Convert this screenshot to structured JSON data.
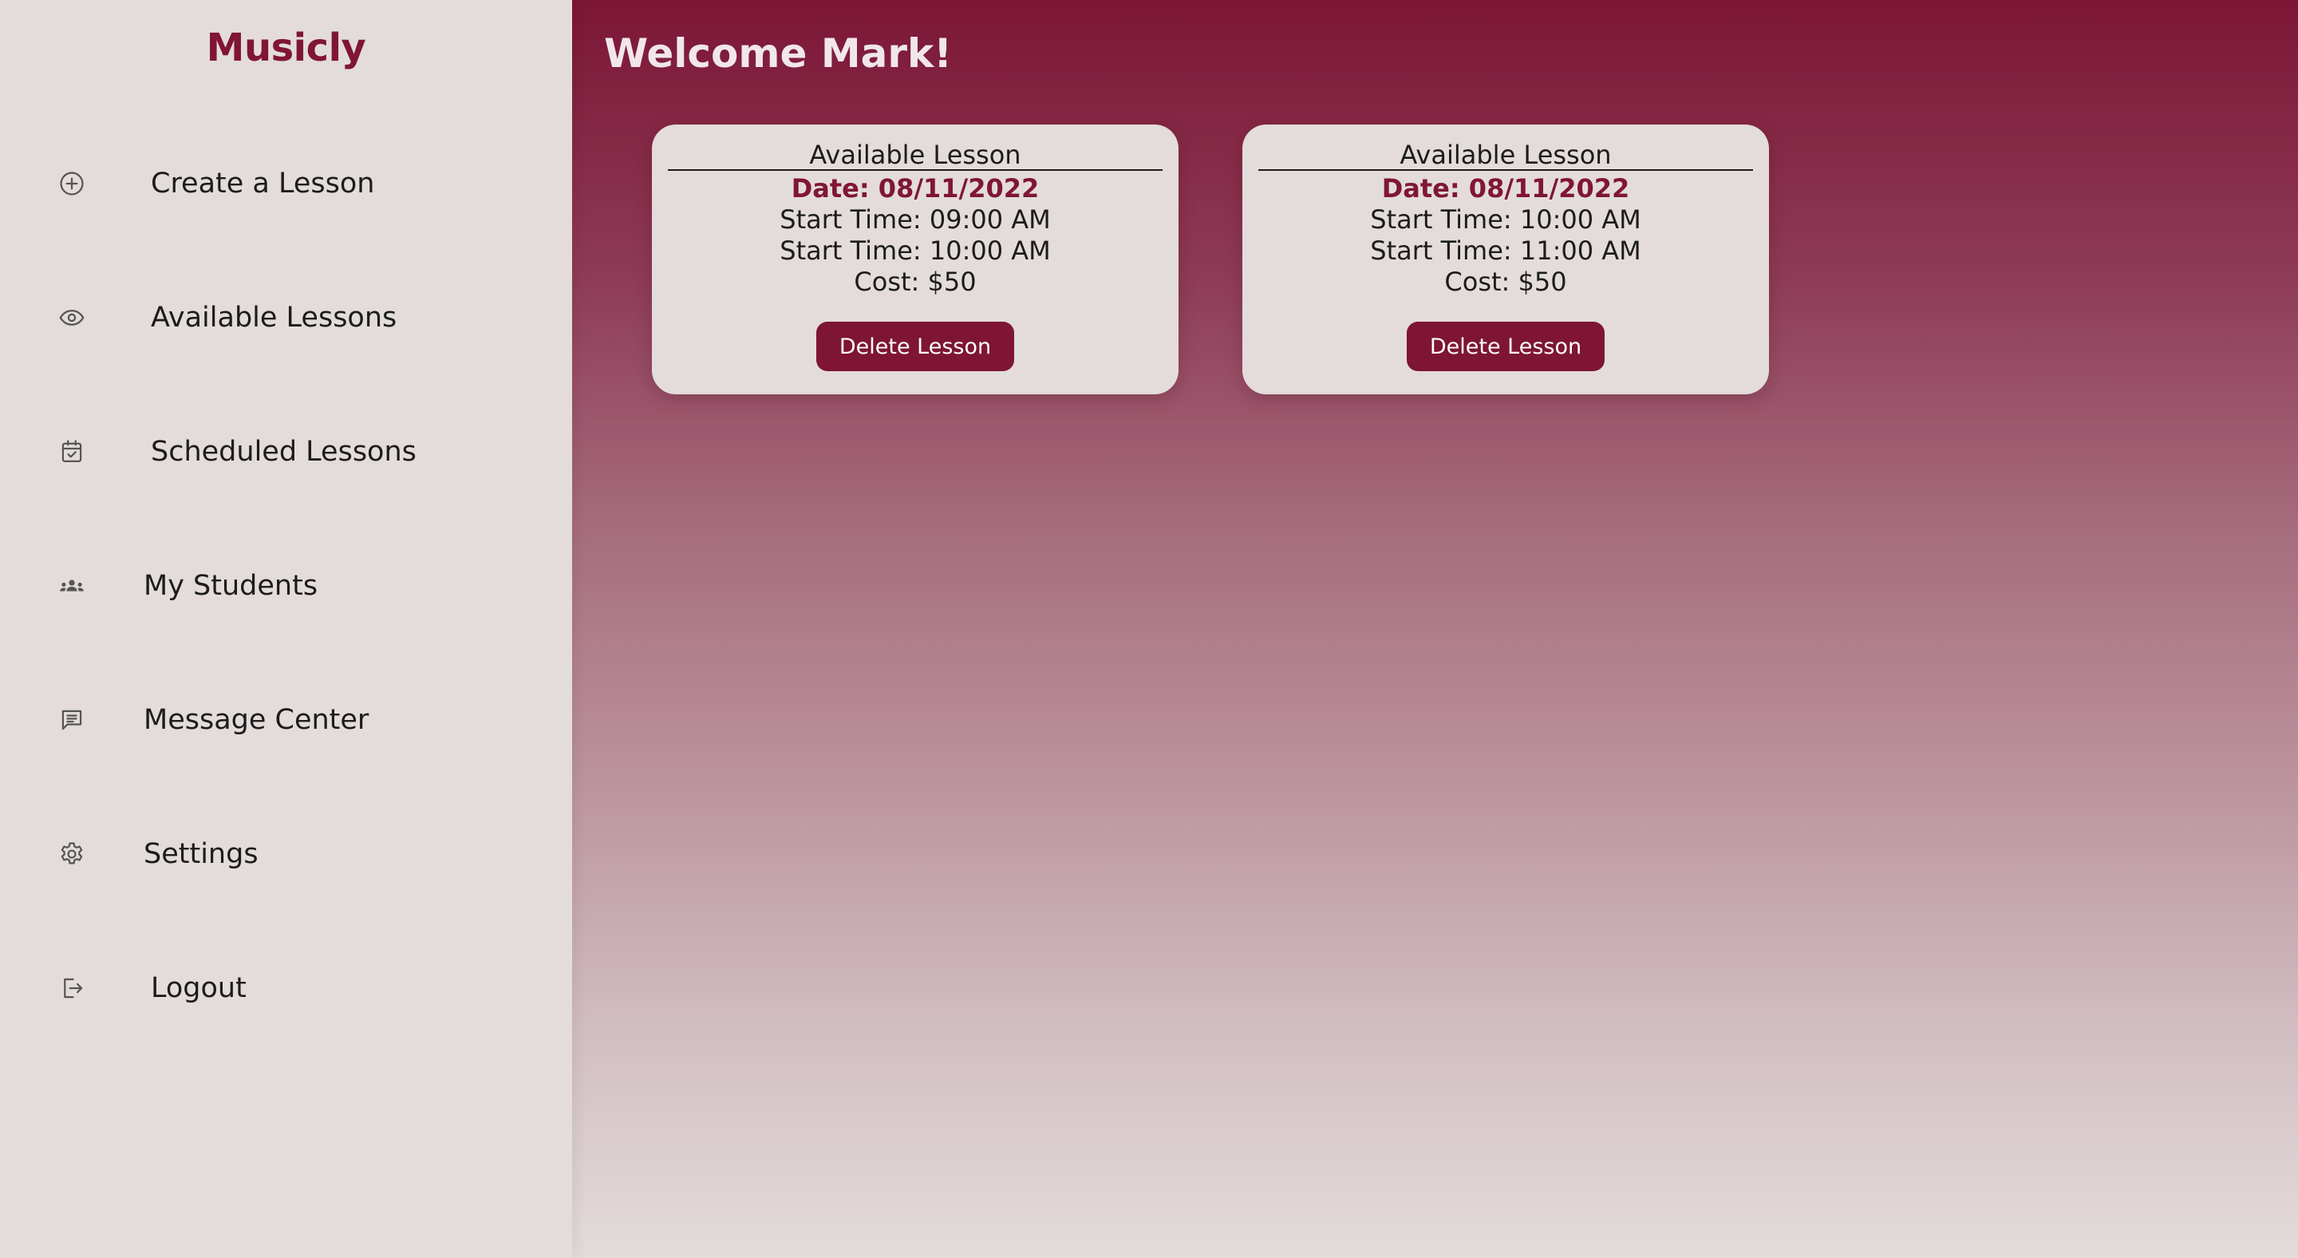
{
  "app": {
    "brand": "Musicly"
  },
  "sidebar": {
    "items": [
      {
        "label": "Create a Lesson",
        "icon": "plus-circle-icon"
      },
      {
        "label": "Available Lessons",
        "icon": "eye-icon"
      },
      {
        "label": "Scheduled Lessons",
        "icon": "calendar-check-icon"
      },
      {
        "label": "My Students",
        "icon": "people-icon"
      },
      {
        "label": "Message Center",
        "icon": "message-icon"
      },
      {
        "label": "Settings",
        "icon": "gear-icon"
      },
      {
        "label": "Logout",
        "icon": "logout-icon"
      }
    ]
  },
  "main": {
    "welcome": "Welcome Mark!",
    "lessons": [
      {
        "title": "Available Lesson",
        "date": "Date: 08/11/2022",
        "start_time": "Start Time: 09:00 AM",
        "end_time": "Start Time: 10:00 AM",
        "cost": "Cost: $50",
        "delete_label": "Delete Lesson"
      },
      {
        "title": "Available Lesson",
        "date": "Date: 08/11/2022",
        "start_time": "Start Time: 10:00 AM",
        "end_time": "Start Time: 11:00 AM",
        "cost": "Cost: $50",
        "delete_label": "Delete Lesson"
      }
    ]
  },
  "colors": {
    "accent": "#801634",
    "sidebar_bg": "#e3dcdb",
    "card_bg": "#e3dcdb",
    "welcome_text": "#f1e7ea"
  }
}
